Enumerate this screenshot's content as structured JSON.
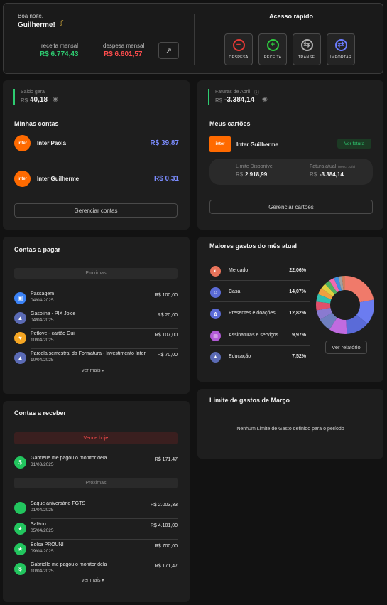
{
  "header": {
    "greeting": "Boa noite,",
    "name": "Guilherme!",
    "income_label": "receita mensal",
    "income_value": "R$ 6.774,43",
    "expense_label": "despesa mensal",
    "expense_value": "R$ 6.601,57"
  },
  "quick_access": {
    "title": "Acesso rápido",
    "buttons": [
      {
        "label": "DESPESA",
        "symbol": "−",
        "color": "#e53935"
      },
      {
        "label": "RECEITA",
        "symbol": "+",
        "color": "#2ecc40"
      },
      {
        "label": "TRANSF.",
        "symbol": "⇆",
        "color": "#b0b0b0"
      },
      {
        "label": "IMPORTAR",
        "symbol": "⇄",
        "color": "#6b7cff"
      }
    ]
  },
  "balance": {
    "label": "Saldo geral",
    "currency": "R$",
    "value": "40,18",
    "accounts_title": "Minhas contas",
    "accounts": [
      {
        "name": "Inter Paola",
        "value": "R$ 39,87"
      },
      {
        "name": "Inter Guilherme",
        "value": "R$ 0,31"
      }
    ],
    "manage_label": "Gerenciar contas"
  },
  "cards": {
    "label": "Faturas de Abril",
    "currency": "R$",
    "value": "-3.384,14",
    "title": "Meus cartões",
    "card_name": "Inter Guilherme",
    "see_invoice": "Ver fatura",
    "limit_label": "Limite Disponível",
    "limit_value": "2.918,99",
    "current_label": "Fatura atual",
    "current_sub": "(Venc. 10/4)",
    "current_value": "-3.384,14",
    "manage_label": "Gerenciar cartões"
  },
  "payables": {
    "title": "Contas a pagar",
    "section": "Próximas",
    "items": [
      {
        "name": "Passagem",
        "date": "04/04/2025",
        "value": "R$ 100,00",
        "color": "#3b82f6",
        "icon": "bus-icon",
        "glyph": "▣"
      },
      {
        "name": "Gasolina - PIX Joice",
        "date": "04/04/2025",
        "value": "R$ 20,00",
        "color": "#5b6bb5",
        "icon": "education-icon",
        "glyph": "▲"
      },
      {
        "name": "Petlove - cartão Gui",
        "date": "10/04/2025",
        "value": "R$ 107,00",
        "color": "#f5a623",
        "icon": "pet-icon",
        "glyph": "♥"
      },
      {
        "name": "Parcela semestral da Formatura - Investimento Inter",
        "date": "10/04/2025",
        "value": "R$ 70,00",
        "color": "#5b6bb5",
        "icon": "education-icon",
        "glyph": "▲"
      }
    ],
    "more": "ver mais"
  },
  "receivables": {
    "title": "Contas a receber",
    "due_today": "Vence hoje",
    "today_items": [
      {
        "name": "Gabrielle me pagou o monitor dela",
        "date": "31/03/2025",
        "value": "R$ 171,47",
        "color": "#22c55e",
        "icon": "money-icon",
        "glyph": "$"
      }
    ],
    "section": "Próximas",
    "items": [
      {
        "name": "Saque aniversário FGTS",
        "date": "01/04/2025",
        "value": "R$ 2.003,33",
        "color": "#22c55e",
        "icon": "more-icon",
        "glyph": "···"
      },
      {
        "name": "Salário",
        "date": "05/04/2025",
        "value": "R$ 4.101,00",
        "color": "#22c55e",
        "icon": "star-icon",
        "glyph": "★"
      },
      {
        "name": "Bolsa PROUNI",
        "date": "09/04/2025",
        "value": "R$ 700,00",
        "color": "#22c55e",
        "icon": "star-icon",
        "glyph": "★"
      },
      {
        "name": "Gabrielle me pagou o monitor dela",
        "date": "10/04/2025",
        "value": "R$ 171,47",
        "color": "#22c55e",
        "icon": "money-icon",
        "glyph": "$"
      }
    ],
    "more": "ver mais"
  },
  "top_expenses": {
    "title": "Maiores gastos do mês atual",
    "items": [
      {
        "name": "Mercado",
        "pct": "22,06%",
        "color": "#e8735a",
        "icon": "cart-icon",
        "glyph": "◐"
      },
      {
        "name": "Casa",
        "pct": "14,07%",
        "color": "#5b6bd6",
        "icon": "home-icon",
        "glyph": "⌂"
      },
      {
        "name": "Presentes e doações",
        "pct": "12,82%",
        "color": "#5b6bd6",
        "icon": "gift-icon",
        "glyph": "✿"
      },
      {
        "name": "Assinaturas e serviços",
        "pct": "9,97%",
        "color": "#b35bd6",
        "icon": "subscription-icon",
        "glyph": "▤"
      },
      {
        "name": "Educação",
        "pct": "7,52%",
        "color": "#5b6bb5",
        "icon": "education-icon",
        "glyph": "▲"
      }
    ],
    "report_button": "Ver relatório"
  },
  "chart_data": {
    "type": "pie",
    "slices": [
      {
        "value": 22.06,
        "color": "#f07a6a"
      },
      {
        "value": 14.07,
        "color": "#6b7cf0"
      },
      {
        "value": 12.82,
        "color": "#5a6bd8"
      },
      {
        "value": 9.97,
        "color": "#c06be0"
      },
      {
        "value": 7.52,
        "color": "#6f7fc0"
      },
      {
        "value": 5.5,
        "color": "#8a7ad0"
      },
      {
        "value": 4.8,
        "color": "#e0506a"
      },
      {
        "value": 4.2,
        "color": "#30c0b0"
      },
      {
        "value": 3.6,
        "color": "#f0a040"
      },
      {
        "value": 3.2,
        "color": "#e0d040"
      },
      {
        "value": 3.0,
        "color": "#50b060"
      },
      {
        "value": 2.8,
        "color": "#f06ab0"
      },
      {
        "value": 2.5,
        "color": "#4090e0"
      },
      {
        "value": 2.0,
        "color": "#a0a0a0"
      },
      {
        "value": 1.96,
        "color": "#d08060"
      }
    ]
  },
  "spending_limit": {
    "title": "Limite de gastos de Março",
    "empty": "Nenhum Limite de Gasto definido para o período"
  }
}
